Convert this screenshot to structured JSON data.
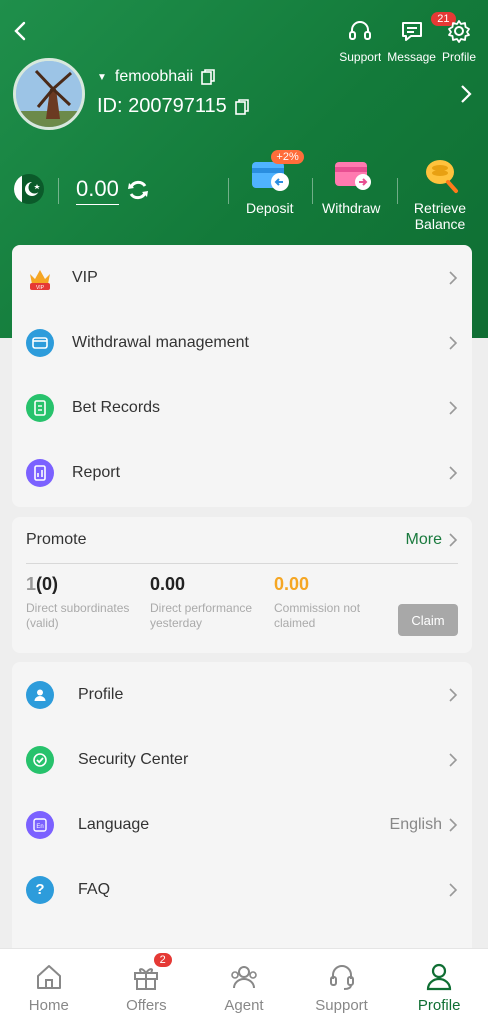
{
  "header": {
    "top_icons": [
      {
        "label": "Support",
        "icon": "headset-icon"
      },
      {
        "label": "Message",
        "icon": "message-icon",
        "badge": "21"
      },
      {
        "label": "Profile",
        "icon": "gear-icon"
      }
    ],
    "username": "femoobhaii",
    "id_text": "ID: 200797115",
    "balance": "0.00",
    "actions": [
      {
        "label": "Deposit",
        "icon": "deposit-icon",
        "badge": "+2%"
      },
      {
        "label": "Withdraw",
        "icon": "withdraw-icon"
      },
      {
        "label": "Retrieve Balance",
        "icon": "coins-search-icon"
      }
    ]
  },
  "menu1": [
    {
      "label": "VIP",
      "icon": "vip-crown-icon",
      "color": "#f5a623"
    },
    {
      "label": "Withdrawal management",
      "icon": "wallet-icon",
      "color": "#2d9cdb"
    },
    {
      "label": "Bet Records",
      "icon": "document-icon",
      "color": "#27c26c"
    },
    {
      "label": "Report",
      "icon": "chart-icon",
      "color": "#7b61ff"
    }
  ],
  "promote": {
    "title": "Promote",
    "more": "More",
    "stats": [
      {
        "value_main": "1",
        "value_sub": "(0)",
        "label": "Direct subordinates (valid)"
      },
      {
        "value_main": "0.00",
        "value_sub": "",
        "label": "Direct performance yesterday"
      },
      {
        "value_main": "0.00",
        "value_sub": "",
        "label": "Commission not claimed"
      }
    ],
    "claim": "Claim"
  },
  "menu2": [
    {
      "label": "Profile",
      "icon": "user-icon",
      "color": "#2d9cdb",
      "extra": ""
    },
    {
      "label": "Security Center",
      "icon": "shield-check-icon",
      "color": "#27c26c",
      "extra": ""
    },
    {
      "label": "Language",
      "icon": "language-icon",
      "color": "#7b61ff",
      "extra": "English"
    },
    {
      "label": "FAQ",
      "icon": "question-icon",
      "color": "#2d9cdb",
      "extra": ""
    }
  ],
  "tabs": [
    {
      "label": "Home",
      "icon": "home-icon"
    },
    {
      "label": "Offers",
      "icon": "gift-icon",
      "badge": "2"
    },
    {
      "label": "Agent",
      "icon": "agent-icon"
    },
    {
      "label": "Support",
      "icon": "headset-icon"
    },
    {
      "label": "Profile",
      "icon": "profile-icon",
      "active": true
    }
  ],
  "colors": {
    "brand_green": "#137a3a",
    "accent_orange": "#f5a623",
    "badge_red": "#e53935"
  }
}
